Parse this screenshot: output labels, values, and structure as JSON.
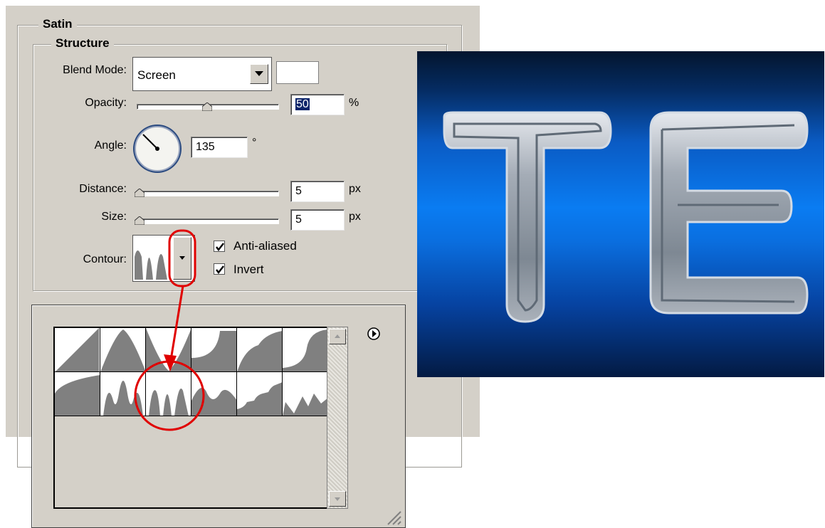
{
  "satin": {
    "title": "Satin",
    "structure": {
      "title": "Structure",
      "blend_mode": {
        "label": "Blend Mode:",
        "value": "Screen"
      },
      "opacity": {
        "label": "Opacity:",
        "value": "50",
        "unit": "%",
        "slider_level": 0.5
      },
      "angle": {
        "label": "Angle:",
        "value": "135",
        "unit": "°"
      },
      "distance": {
        "label": "Distance:",
        "value": "5",
        "unit": "px",
        "slider_level": 0.02
      },
      "size": {
        "label": "Size:",
        "value": "5",
        "unit": "px",
        "slider_level": 0.02
      },
      "contour": {
        "label": "Contour:"
      },
      "anti_aliased": {
        "label": "Anti-aliased",
        "checked": true
      },
      "invert": {
        "label": "Invert",
        "checked": true
      }
    }
  },
  "contour_picker": {
    "presets": [
      "linear",
      "cone",
      "cone-inverted",
      "cove-deep",
      "cove-shallow",
      "gaussian",
      "half-round",
      "ring",
      "ring-double",
      "rolling-slope",
      "rounded-steps",
      "sawtooth"
    ],
    "selected": "ring-double",
    "menu_icon": "play-circle-icon"
  },
  "preview": {
    "text": "TE"
  },
  "colors": {
    "dialog_bg": "#d4d0c8",
    "highlight": "#e00000",
    "selection": "#0a246a",
    "preview_blue": "#0a7cf2"
  }
}
